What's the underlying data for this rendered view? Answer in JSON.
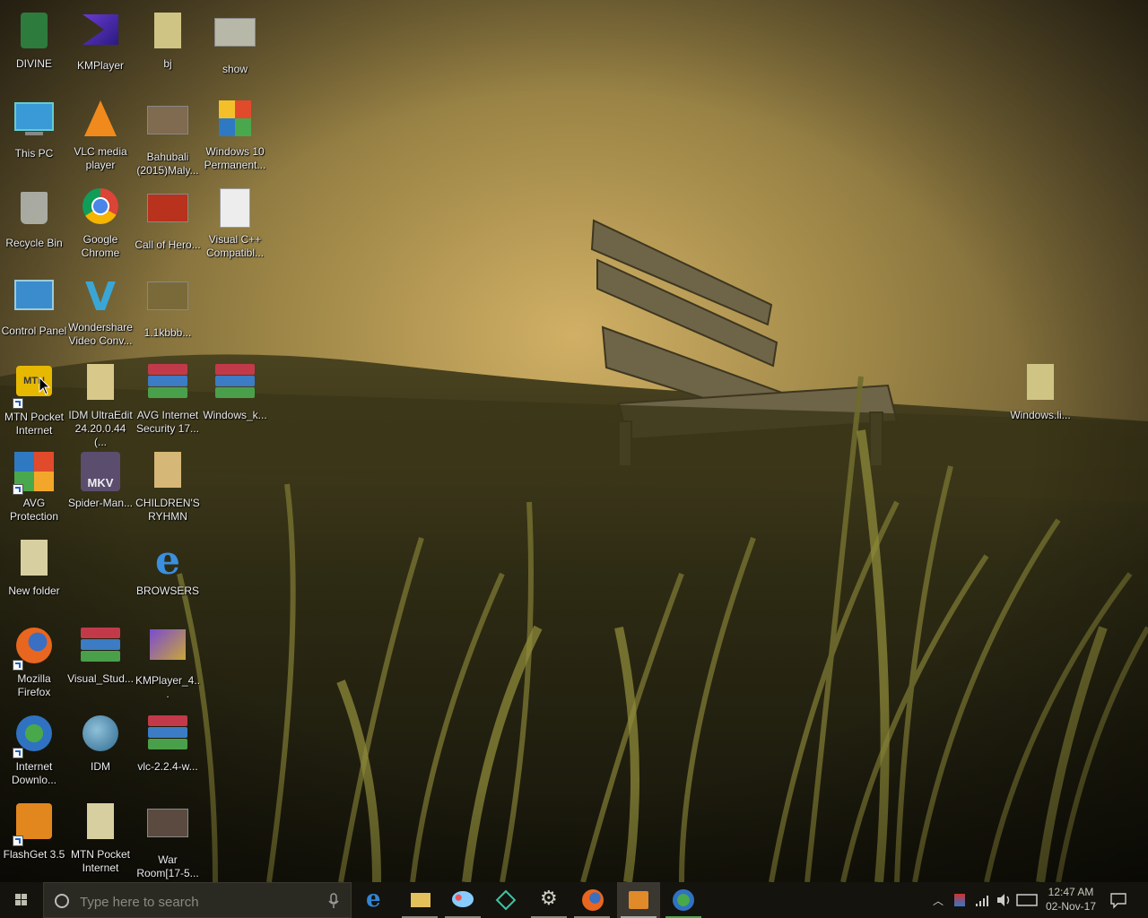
{
  "desktop": {
    "icons": [
      {
        "label": "DIVINE",
        "icon": "app-icon"
      },
      {
        "label": "KMPlayer",
        "icon": "kmplayer-icon"
      },
      {
        "label": "bj",
        "icon": "folder-icon"
      },
      {
        "label": "show",
        "icon": "image-icon"
      },
      {
        "label": "This PC",
        "icon": "computer-icon"
      },
      {
        "label": "VLC media player",
        "icon": "vlc-icon"
      },
      {
        "label": "Bahubali (2015)Maly...",
        "icon": "video-icon"
      },
      {
        "label": "Windows 10 Permanent...",
        "icon": "keys-icon"
      },
      {
        "label": "Recycle Bin",
        "icon": "recycle-bin-icon"
      },
      {
        "label": "Google Chrome",
        "icon": "chrome-icon"
      },
      {
        "label": "Call of Hero...",
        "icon": "video-icon"
      },
      {
        "label": "Visual C++ Compatibl...",
        "icon": "installer-icon"
      },
      {
        "label": "Control Panel",
        "icon": "control-panel-icon"
      },
      {
        "label": "Wondershare Video Conv...",
        "icon": "wondershare-icon"
      },
      {
        "label": "1.1kbbb...",
        "icon": "video-icon"
      },
      {
        "label": "MTN Pocket Internet",
        "icon": "mtn-icon"
      },
      {
        "label": "IDM UltraEdit 24.20.0.44 (...",
        "icon": "folder-icon"
      },
      {
        "label": "AVG Internet Security 17...",
        "icon": "winrar-icon"
      },
      {
        "label": "Windows_k...",
        "icon": "winrar-icon"
      },
      {
        "label": "AVG Protection",
        "icon": "avg-icon"
      },
      {
        "label": "Spider-Man...",
        "icon": "mkv-icon"
      },
      {
        "label": "CHILDREN'S RYHMN",
        "icon": "folder-icon"
      },
      {
        "label": "New folder",
        "icon": "folder-icon"
      },
      {
        "label": "BROWSERS",
        "icon": "internet-explorer-icon"
      },
      {
        "label": "Mozilla Firefox",
        "icon": "firefox-icon"
      },
      {
        "label": "Visual_Stud...",
        "icon": "winrar-icon"
      },
      {
        "label": "KMPlayer_4...",
        "icon": "kmplayer-installer-icon"
      },
      {
        "label": "Internet Downlo...",
        "icon": "idm-icon"
      },
      {
        "label": "IDM",
        "icon": "idm-globe-icon"
      },
      {
        "label": "vlc-2.2.4-w...",
        "icon": "winrar-icon"
      },
      {
        "label": "FlashGet 3.5",
        "icon": "flashget-icon"
      },
      {
        "label": "MTN Pocket Internet",
        "icon": "folder-icon"
      },
      {
        "label": "War Room[17-5...",
        "icon": "video-icon"
      },
      {
        "label": "Windows.li...",
        "icon": "folder-icon"
      }
    ]
  },
  "taskbar": {
    "search_placeholder": "Type here to search",
    "apps": [
      {
        "name": "Microsoft Edge",
        "icon": "edge-icon"
      },
      {
        "name": "File Explorer",
        "icon": "file-explorer-icon"
      },
      {
        "name": "Paint",
        "icon": "paint-icon"
      },
      {
        "name": "App",
        "icon": "diamond-app-icon"
      },
      {
        "name": "Settings",
        "icon": "gear-icon"
      },
      {
        "name": "Firefox",
        "icon": "firefox-icon"
      },
      {
        "name": "Media Player",
        "icon": "media-player-icon"
      },
      {
        "name": "Internet Download Manager",
        "icon": "idm-icon"
      }
    ],
    "clock": {
      "time": "12:47 AM",
      "date": "02-Nov-17"
    }
  },
  "colors": {
    "taskbar": "#14130d",
    "label_text": "#ececec",
    "sky_glow": "#c9a75a"
  }
}
